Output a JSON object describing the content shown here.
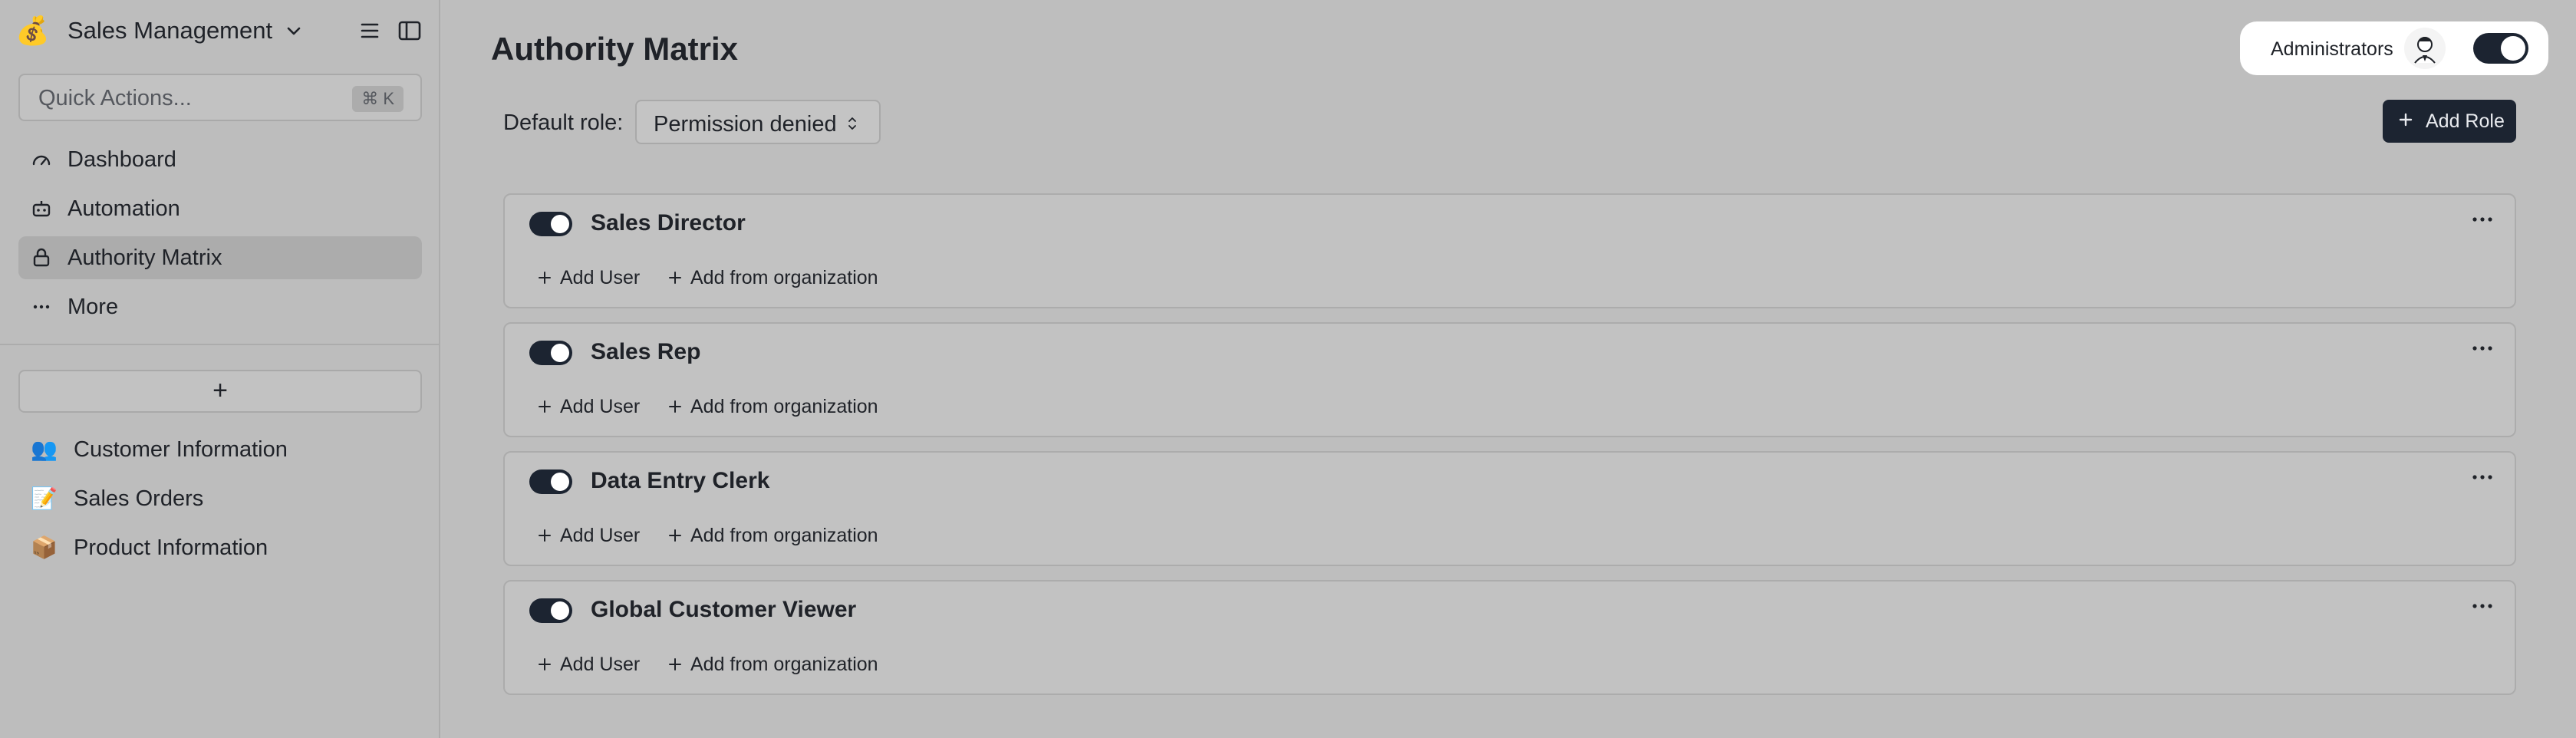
{
  "sidebar": {
    "workspace_name": "Sales Management",
    "logo_emoji": "💰",
    "quick_actions_placeholder": "Quick Actions...",
    "quick_actions_shortcut": "⌘ K",
    "nav": [
      {
        "label": "Dashboard",
        "icon": "dashboard-icon"
      },
      {
        "label": "Automation",
        "icon": "robot-icon"
      },
      {
        "label": "Authority Matrix",
        "icon": "lock-icon",
        "active": true
      },
      {
        "label": "More",
        "icon": "ellipsis-icon"
      }
    ],
    "add_table_label": "+",
    "tables": [
      {
        "emoji": "👥",
        "label": "Customer Information"
      },
      {
        "emoji": "📝",
        "label": "Sales Orders"
      },
      {
        "emoji": "📦",
        "label": "Product Information"
      }
    ]
  },
  "main": {
    "title": "Authority Matrix",
    "admin_label": "Administrators",
    "admin_toggle_on": true,
    "default_role_label": "Default role:",
    "default_role_value": "Permission denied",
    "add_role_label": "Add Role",
    "add_user_label": "Add User",
    "add_from_org_label": "Add from organization",
    "roles": [
      {
        "name": "Sales Director",
        "enabled": true
      },
      {
        "name": "Sales Rep",
        "enabled": true
      },
      {
        "name": "Data Entry Clerk",
        "enabled": true
      },
      {
        "name": "Global Customer Viewer",
        "enabled": true
      }
    ]
  },
  "colors": {
    "accent_dark": "#1c2431",
    "sidebar_bg": "#bdbdbd",
    "active_item_bg": "#acacac"
  }
}
